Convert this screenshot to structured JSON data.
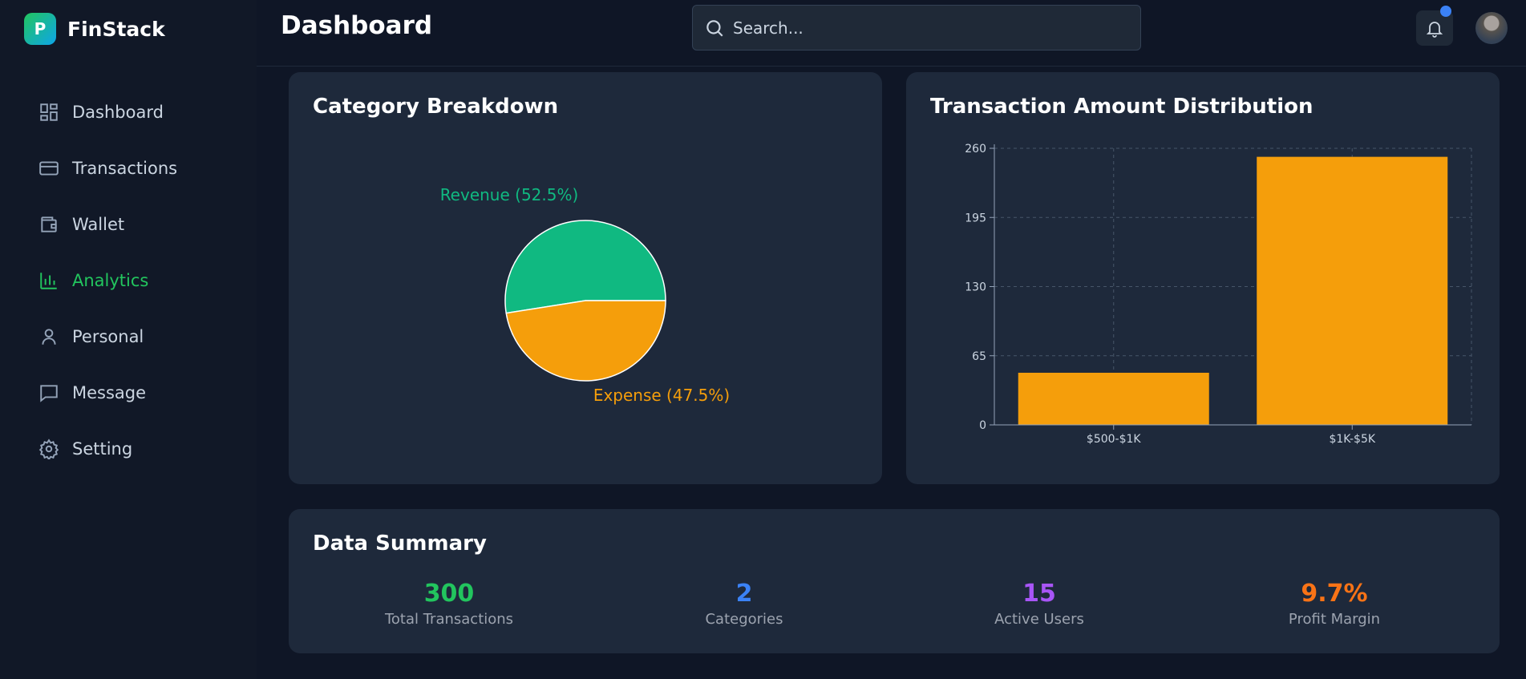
{
  "brand": {
    "logo_letter": "P",
    "name": "FinStack"
  },
  "sidebar": {
    "items": [
      {
        "label": "Dashboard",
        "icon": "grid-icon",
        "active": false
      },
      {
        "label": "Transactions",
        "icon": "credit-card-icon",
        "active": false
      },
      {
        "label": "Wallet",
        "icon": "wallet-icon",
        "active": false
      },
      {
        "label": "Analytics",
        "icon": "bar-chart-icon",
        "active": true
      },
      {
        "label": "Personal",
        "icon": "user-icon",
        "active": false
      },
      {
        "label": "Message",
        "icon": "message-icon",
        "active": false
      },
      {
        "label": "Setting",
        "icon": "gear-icon",
        "active": false
      }
    ]
  },
  "header": {
    "title": "Dashboard",
    "search_placeholder": "Search...",
    "has_notification": true
  },
  "cards": {
    "pie_title": "Category Breakdown",
    "bar_title": "Transaction Amount Distribution",
    "summary_title": "Data Summary"
  },
  "chart_data": [
    {
      "type": "pie",
      "title": "Category Breakdown",
      "slices": [
        {
          "label": "Revenue (52.5%)",
          "value": 52.5,
          "color": "#10b981"
        },
        {
          "label": "Expense (47.5%)",
          "value": 47.5,
          "color": "#f59e0b"
        }
      ]
    },
    {
      "type": "bar",
      "title": "Transaction Amount Distribution",
      "categories": [
        "$500-$1K",
        "$1K-$5K"
      ],
      "values": [
        49,
        252
      ],
      "color": "#f59e0b",
      "ylim": [
        0,
        260
      ],
      "yticks": [
        0,
        65,
        130,
        195,
        260
      ],
      "grid": true
    }
  ],
  "summary": [
    {
      "value": "300",
      "label": "Total Transactions",
      "color": "#22c55e"
    },
    {
      "value": "2",
      "label": "Categories",
      "color": "#3b82f6"
    },
    {
      "value": "15",
      "label": "Active Users",
      "color": "#a855f7"
    },
    {
      "value": "9.7%",
      "label": "Profit Margin",
      "color": "#f97316"
    }
  ]
}
